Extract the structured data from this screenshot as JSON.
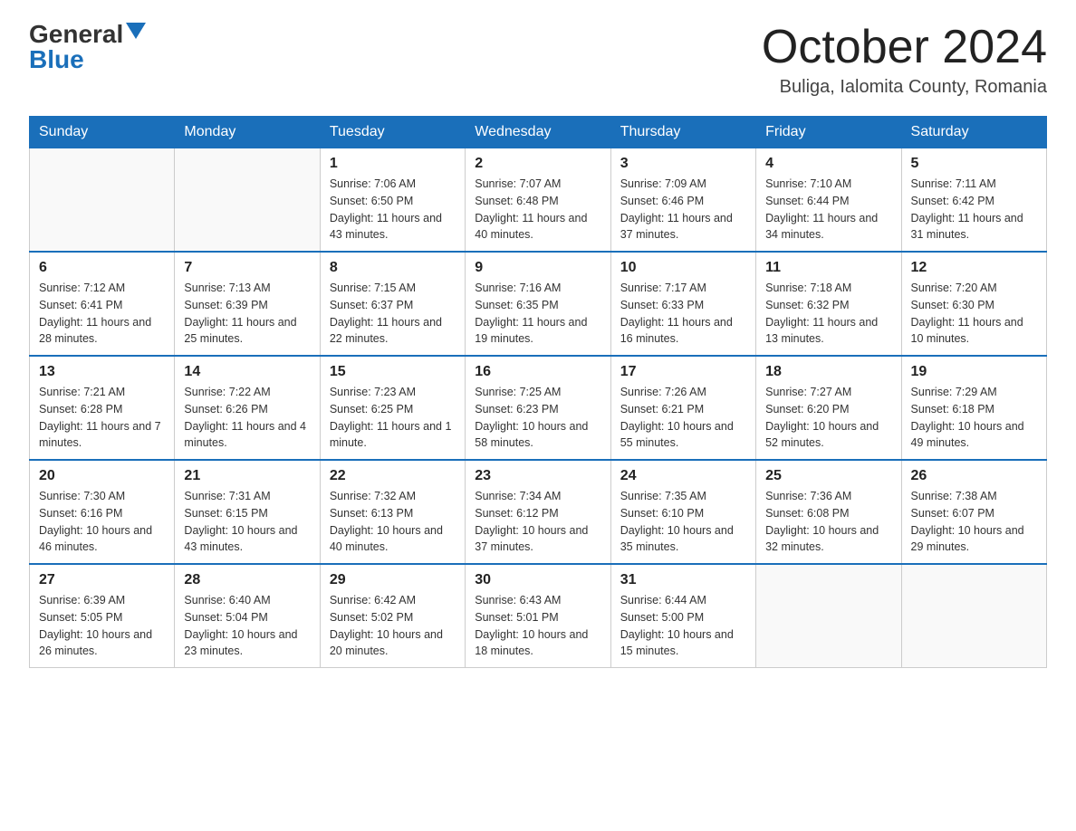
{
  "logo": {
    "general": "General",
    "arrow": "▶",
    "blue": "Blue"
  },
  "title": "October 2024",
  "location": "Buliga, Ialomita County, Romania",
  "days_of_week": [
    "Sunday",
    "Monday",
    "Tuesday",
    "Wednesday",
    "Thursday",
    "Friday",
    "Saturday"
  ],
  "weeks": [
    [
      {
        "day": "",
        "info": ""
      },
      {
        "day": "",
        "info": ""
      },
      {
        "day": "1",
        "sunrise": "7:06 AM",
        "sunset": "6:50 PM",
        "daylight": "11 hours and 43 minutes."
      },
      {
        "day": "2",
        "sunrise": "7:07 AM",
        "sunset": "6:48 PM",
        "daylight": "11 hours and 40 minutes."
      },
      {
        "day": "3",
        "sunrise": "7:09 AM",
        "sunset": "6:46 PM",
        "daylight": "11 hours and 37 minutes."
      },
      {
        "day": "4",
        "sunrise": "7:10 AM",
        "sunset": "6:44 PM",
        "daylight": "11 hours and 34 minutes."
      },
      {
        "day": "5",
        "sunrise": "7:11 AM",
        "sunset": "6:42 PM",
        "daylight": "11 hours and 31 minutes."
      }
    ],
    [
      {
        "day": "6",
        "sunrise": "7:12 AM",
        "sunset": "6:41 PM",
        "daylight": "11 hours and 28 minutes."
      },
      {
        "day": "7",
        "sunrise": "7:13 AM",
        "sunset": "6:39 PM",
        "daylight": "11 hours and 25 minutes."
      },
      {
        "day": "8",
        "sunrise": "7:15 AM",
        "sunset": "6:37 PM",
        "daylight": "11 hours and 22 minutes."
      },
      {
        "day": "9",
        "sunrise": "7:16 AM",
        "sunset": "6:35 PM",
        "daylight": "11 hours and 19 minutes."
      },
      {
        "day": "10",
        "sunrise": "7:17 AM",
        "sunset": "6:33 PM",
        "daylight": "11 hours and 16 minutes."
      },
      {
        "day": "11",
        "sunrise": "7:18 AM",
        "sunset": "6:32 PM",
        "daylight": "11 hours and 13 minutes."
      },
      {
        "day": "12",
        "sunrise": "7:20 AM",
        "sunset": "6:30 PM",
        "daylight": "11 hours and 10 minutes."
      }
    ],
    [
      {
        "day": "13",
        "sunrise": "7:21 AM",
        "sunset": "6:28 PM",
        "daylight": "11 hours and 7 minutes."
      },
      {
        "day": "14",
        "sunrise": "7:22 AM",
        "sunset": "6:26 PM",
        "daylight": "11 hours and 4 minutes."
      },
      {
        "day": "15",
        "sunrise": "7:23 AM",
        "sunset": "6:25 PM",
        "daylight": "11 hours and 1 minute."
      },
      {
        "day": "16",
        "sunrise": "7:25 AM",
        "sunset": "6:23 PM",
        "daylight": "10 hours and 58 minutes."
      },
      {
        "day": "17",
        "sunrise": "7:26 AM",
        "sunset": "6:21 PM",
        "daylight": "10 hours and 55 minutes."
      },
      {
        "day": "18",
        "sunrise": "7:27 AM",
        "sunset": "6:20 PM",
        "daylight": "10 hours and 52 minutes."
      },
      {
        "day": "19",
        "sunrise": "7:29 AM",
        "sunset": "6:18 PM",
        "daylight": "10 hours and 49 minutes."
      }
    ],
    [
      {
        "day": "20",
        "sunrise": "7:30 AM",
        "sunset": "6:16 PM",
        "daylight": "10 hours and 46 minutes."
      },
      {
        "day": "21",
        "sunrise": "7:31 AM",
        "sunset": "6:15 PM",
        "daylight": "10 hours and 43 minutes."
      },
      {
        "day": "22",
        "sunrise": "7:32 AM",
        "sunset": "6:13 PM",
        "daylight": "10 hours and 40 minutes."
      },
      {
        "day": "23",
        "sunrise": "7:34 AM",
        "sunset": "6:12 PM",
        "daylight": "10 hours and 37 minutes."
      },
      {
        "day": "24",
        "sunrise": "7:35 AM",
        "sunset": "6:10 PM",
        "daylight": "10 hours and 35 minutes."
      },
      {
        "day": "25",
        "sunrise": "7:36 AM",
        "sunset": "6:08 PM",
        "daylight": "10 hours and 32 minutes."
      },
      {
        "day": "26",
        "sunrise": "7:38 AM",
        "sunset": "6:07 PM",
        "daylight": "10 hours and 29 minutes."
      }
    ],
    [
      {
        "day": "27",
        "sunrise": "6:39 AM",
        "sunset": "5:05 PM",
        "daylight": "10 hours and 26 minutes."
      },
      {
        "day": "28",
        "sunrise": "6:40 AM",
        "sunset": "5:04 PM",
        "daylight": "10 hours and 23 minutes."
      },
      {
        "day": "29",
        "sunrise": "6:42 AM",
        "sunset": "5:02 PM",
        "daylight": "10 hours and 20 minutes."
      },
      {
        "day": "30",
        "sunrise": "6:43 AM",
        "sunset": "5:01 PM",
        "daylight": "10 hours and 18 minutes."
      },
      {
        "day": "31",
        "sunrise": "6:44 AM",
        "sunset": "5:00 PM",
        "daylight": "10 hours and 15 minutes."
      },
      {
        "day": "",
        "info": ""
      },
      {
        "day": "",
        "info": ""
      }
    ]
  ]
}
